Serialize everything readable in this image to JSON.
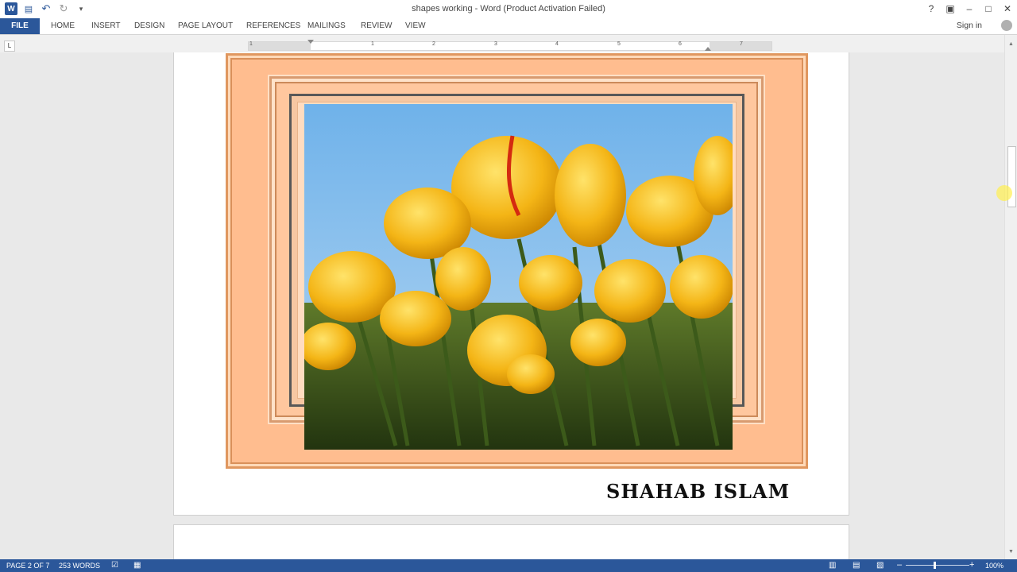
{
  "window": {
    "title": "shapes working - Word (Product Activation Failed)",
    "help": "?",
    "minimize": "–",
    "restore": "□",
    "close": "✕",
    "ribbon_display": "▣"
  },
  "qat": {
    "app_icon": "W",
    "save": "💾",
    "undo": "↶",
    "redo": "↻",
    "customize": "▾"
  },
  "tabs": {
    "file": "FILE",
    "home": "HOME",
    "insert": "INSERT",
    "design": "DESIGN",
    "page_layout": "PAGE LAYOUT",
    "references": "REFERENCES",
    "mailings": "MAILINGS",
    "review": "REVIEW",
    "view": "VIEW"
  },
  "account": {
    "sign_in": "Sign in"
  },
  "ruler": {
    "tab_selector": "L",
    "numbers": [
      "1",
      "1",
      "2",
      "3",
      "4",
      "5",
      "6",
      "7"
    ]
  },
  "document": {
    "signature_text": "SHAHAB ISLAM",
    "image_subject": "yellow tulips under blue sky"
  },
  "status": {
    "page": "PAGE 2 OF 7",
    "words": "253 WORDS",
    "zoom": "100%",
    "zoom_level": 1.0
  },
  "colors": {
    "accent": "#2b579a",
    "frame_outer": "#ffbd8f",
    "frame_inner": "#f6c7a2",
    "frame_dark_border": "#585858"
  }
}
